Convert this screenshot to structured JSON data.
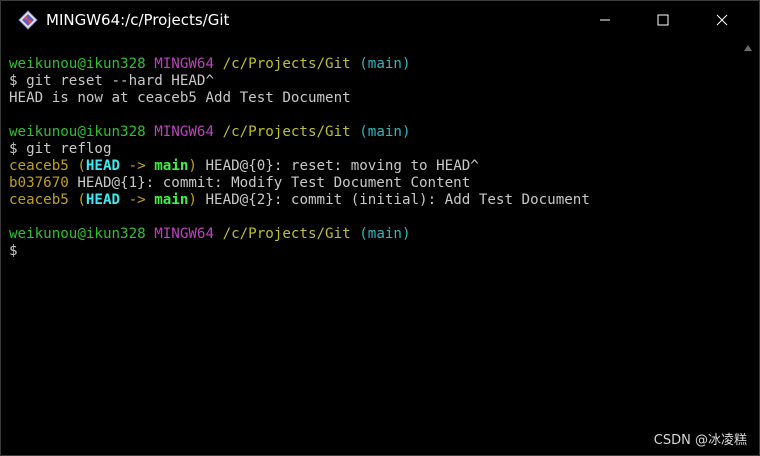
{
  "window": {
    "title": "MINGW64:/c/Projects/Git",
    "controls": {
      "minimize": "minimize-icon",
      "maximize": "maximize-icon",
      "close": "close-icon"
    }
  },
  "terminal": {
    "lines": [
      [
        {
          "text": "weikunou@ikun328",
          "color": "green"
        },
        {
          "text": " ",
          "color": "white"
        },
        {
          "text": "MINGW64",
          "color": "magenta"
        },
        {
          "text": " ",
          "color": "white"
        },
        {
          "text": "/c/Projects/Git",
          "color": "yellow"
        },
        {
          "text": " ",
          "color": "white"
        },
        {
          "text": "(main)",
          "color": "cyan"
        }
      ],
      [
        {
          "text": "$ git reset --hard HEAD^",
          "color": "white"
        }
      ],
      [
        {
          "text": "HEAD is now at ceaceb5 Add Test Document",
          "color": "white"
        }
      ],
      [],
      [
        {
          "text": "weikunou@ikun328",
          "color": "green"
        },
        {
          "text": " ",
          "color": "white"
        },
        {
          "text": "MINGW64",
          "color": "magenta"
        },
        {
          "text": " ",
          "color": "white"
        },
        {
          "text": "/c/Projects/Git",
          "color": "yellow"
        },
        {
          "text": " ",
          "color": "white"
        },
        {
          "text": "(main)",
          "color": "cyan"
        }
      ],
      [
        {
          "text": "$ git reflog",
          "color": "white"
        }
      ],
      [
        {
          "text": "ceaceb5",
          "color": "hash"
        },
        {
          "text": " (",
          "color": "hash"
        },
        {
          "text": "HEAD",
          "color": "bcyan"
        },
        {
          "text": " -> ",
          "color": "hash"
        },
        {
          "text": "main",
          "color": "bgreen"
        },
        {
          "text": ")",
          "color": "hash"
        },
        {
          "text": " HEAD@{0}: reset: moving to HEAD^",
          "color": "white"
        }
      ],
      [
        {
          "text": "b037670",
          "color": "hash"
        },
        {
          "text": " HEAD@{1}: commit: Modify Test Document Content",
          "color": "white"
        }
      ],
      [
        {
          "text": "ceaceb5",
          "color": "hash"
        },
        {
          "text": " (",
          "color": "hash"
        },
        {
          "text": "HEAD",
          "color": "bcyan"
        },
        {
          "text": " -> ",
          "color": "hash"
        },
        {
          "text": "main",
          "color": "bgreen"
        },
        {
          "text": ")",
          "color": "hash"
        },
        {
          "text": " HEAD@{2}: commit (initial): Add Test Document",
          "color": "white"
        }
      ],
      [],
      [
        {
          "text": "weikunou@ikun328",
          "color": "green"
        },
        {
          "text": " ",
          "color": "white"
        },
        {
          "text": "MINGW64",
          "color": "magenta"
        },
        {
          "text": " ",
          "color": "white"
        },
        {
          "text": "/c/Projects/Git",
          "color": "yellow"
        },
        {
          "text": " ",
          "color": "white"
        },
        {
          "text": "(main)",
          "color": "cyan"
        }
      ],
      [
        {
          "text": "$",
          "color": "white"
        }
      ]
    ]
  },
  "watermark": "CSDN @冰凌糕",
  "colors": {
    "background": "#000000",
    "green": "#2fbf2f",
    "magenta": "#bf40bf",
    "yellow": "#bfbf2f",
    "cyan": "#2fb5bf",
    "white": "#c8c8c8",
    "hash": "#c0a020",
    "bcyan": "#40e8f0",
    "bgreen": "#40f040"
  }
}
